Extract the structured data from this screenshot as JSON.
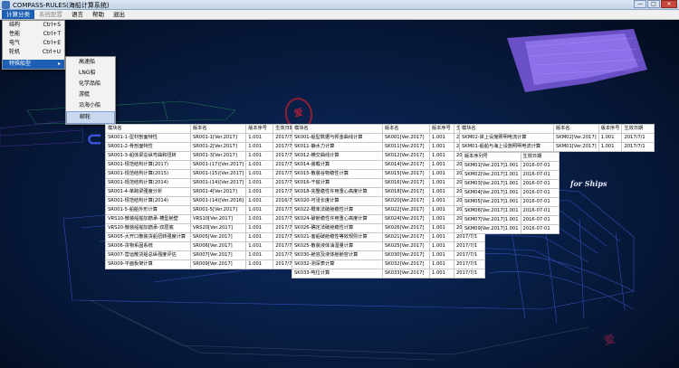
{
  "window": {
    "title": "COMPASS-RULES(海船计算系统)",
    "controls": [
      "—",
      "□",
      "✕"
    ]
  },
  "menubar": {
    "items": [
      {
        "label": "计算分类",
        "state": "active"
      },
      {
        "label": "系统配置",
        "state": "disabled"
      },
      {
        "label": "语言",
        "state": "normal"
      },
      {
        "label": "帮助",
        "state": "normal"
      },
      {
        "label": "退出",
        "state": "normal"
      }
    ]
  },
  "dropdown": {
    "items": [
      {
        "label": "结构",
        "shortcut": "Ctrl+S"
      },
      {
        "label": "性能",
        "shortcut": "Ctrl+T"
      },
      {
        "label": "电气",
        "shortcut": "Ctrl+E"
      },
      {
        "label": "轮机",
        "shortcut": "Ctrl+U"
      },
      {
        "label": "特殊船型",
        "shortcut": "▸"
      }
    ]
  },
  "submenu": {
    "items": [
      "高速船",
      "LNG船",
      "化学品船",
      "游艇",
      "沿海小船",
      "邮轮"
    ]
  },
  "banner": "RU",
  "banner_prefix": "⊂",
  "subtitle": "for Ships",
  "watermark_text": "爱",
  "table1": {
    "headers": [
      "模块名",
      "版本名",
      "版本序号",
      "生效日期"
    ],
    "rows": [
      [
        "SR001-1-型材剖面特性",
        "SR001-1[Ver.2017]",
        "1.001",
        "2017/7/1"
      ],
      [
        "SR001-2-骨剖面特性",
        "SR001-2[Ver.2017]",
        "1.001",
        "2017/7/1"
      ],
      [
        "SR001-3-船体梁总纵弯曲和扭转",
        "SR001-3[Ver.2017]",
        "1.001",
        "2017/7/1"
      ],
      [
        "SR001-规范结构计算(2017)",
        "SR001-(17)[Ver.2017]",
        "1.001",
        "2017/7/1"
      ],
      [
        "SR001-规范结构计算(2015)",
        "SR001-(15)[Ver.2017]",
        "1.001",
        "2017/7/1"
      ],
      [
        "SR001-规范结构计算(2014)",
        "SR001-(14)[Ver.2017]",
        "1.001",
        "2017/7/1"
      ],
      [
        "SR001-4-单跨梁强度分析",
        "SR001-4[Ver.2017]",
        "1.001",
        "2017/7/1"
      ],
      [
        "SR001-规范结构计算(2014)",
        "SR001-(14)[Ver.2016]",
        "1.001",
        "2016/7/1"
      ],
      [
        "SR001-5-船舶外形计算",
        "SR001-5[Ver.2017]",
        "1.001",
        "2017/7/1"
      ],
      [
        "VRS10-散装船舶加筋承-槽型舱壁",
        "VRS10[Ver.2017]",
        "1.001",
        "2017/7/1"
      ],
      [
        "VRS20-散装船舶加筋承-双层底",
        "VRS20[Ver.2017]",
        "1.001",
        "2017/7/1"
      ],
      [
        "SR005-大开口散装货船扭转强度计算",
        "SR005[Ver.2017]",
        "1.001",
        "2017/7/1"
      ],
      [
        "SR006-货物系固系统",
        "SR006[Ver.2017]",
        "1.001",
        "2017/7/1"
      ],
      [
        "SR007-营运散货船总纵强度评估",
        "SR007[Ver.2017]",
        "1.001",
        "2017/7/1"
      ],
      [
        "SR009-平面板架计算",
        "SR009[Ver.2017]",
        "1.001",
        "2017/7/1"
      ]
    ]
  },
  "table2": {
    "headers": [
      "模块名",
      "版本名",
      "版本序号",
      "生效日期"
    ],
    "rows": [
      [
        "SK001-船型数据与邦金曲线计算",
        "SK001[Ver.2017]",
        "1.001",
        "2017/7/1"
      ],
      [
        "SK011-静水力计算",
        "SK011[Ver.2017]",
        "1.001",
        "2017/7/1"
      ],
      [
        "SK012-横交曲线计算",
        "SK012[Ver.2017]",
        "1.001",
        "2017/7/1"
      ],
      [
        "SK014-装载计算",
        "SK014[Ver.2017]",
        "1.001",
        "2017/7/1"
      ],
      [
        "SK015-散装谷物稳性计算",
        "SK015[Ver.2017]",
        "1.001",
        "2017/7/1"
      ],
      [
        "SK016-干舷计算",
        "SK016[Ver.2017]",
        "1.001",
        "2017/7/1"
      ],
      [
        "SK018-完整稳性许用重心高度计算",
        "SK018[Ver.2017]",
        "1.001",
        "2017/7/1"
      ],
      [
        "SK020-可浸长度计算",
        "SK020[Ver.2017]",
        "1.001",
        "2017/7/1"
      ],
      [
        "SK022-概率法破舱稳性计算",
        "SK022[Ver.2017]",
        "1.001",
        "2017/7/1"
      ],
      [
        "SK024-破舱稳性许用重心高度计算",
        "SK024[Ver.2017]",
        "1.001",
        "2017/7/1"
      ],
      [
        "SK026-确定法破舱稳性计算",
        "SK026[Ver.2017]",
        "1.001",
        "2017/7/1"
      ],
      [
        "SK021-客船破舱稳性等效规则计算",
        "SK021[Ver.2017]",
        "1.001",
        "2017/7/1"
      ],
      [
        "SK025-散装液体油湿量计算",
        "SK025[Ver.2017]",
        "1.001",
        "2017/7/1"
      ],
      [
        "SK030-舱容及液体舱舱容计算",
        "SK030[Ver.2017]",
        "1.001",
        "2017/7/1"
      ],
      [
        "SK032-测深表计算",
        "SK032[Ver.2017]",
        "1.001",
        "2017/7/1"
      ],
      [
        "SK033-吨位计算",
        "SK033[Ver.2017]",
        "1.001",
        "2017/7/1"
      ]
    ]
  },
  "table3": {
    "headers": [
      "模块名",
      "版本名",
      "版本序号",
      "生效日期"
    ],
    "rows": [
      [
        "SKM02-岸上设施照明电流计算",
        "SKM02[Ver.2017]",
        "1.001",
        "2017/7/1"
      ],
      [
        "SKM01-船舶与海上设施照明电流计算",
        "SKM01[Ver.2017]",
        "1.001",
        "2017/7/1"
      ]
    ]
  },
  "table4": {
    "headers": [
      "版本序列号",
      "生效日期"
    ],
    "rows": [
      [
        "SKM01[Ver.2017]1.001",
        "2016-07-01"
      ],
      [
        "SKM02[Ver.2017]1.001",
        "2016-07-01"
      ],
      [
        "SKM03[Ver.2017]1.001",
        "2016-07-01"
      ],
      [
        "SKM04[Ver.2017]1.001",
        "2016-07-01"
      ],
      [
        "SKM05[Ver.2017]1.001",
        "2016-07-01"
      ],
      [
        "SKM06[Ver.2017]1.001",
        "2016-07-01"
      ],
      [
        "SKM07[Ver.2017]1.001",
        "2016-07-01"
      ],
      [
        "SKM09[Ver.2017]1.001",
        "2016-07-01"
      ]
    ]
  }
}
